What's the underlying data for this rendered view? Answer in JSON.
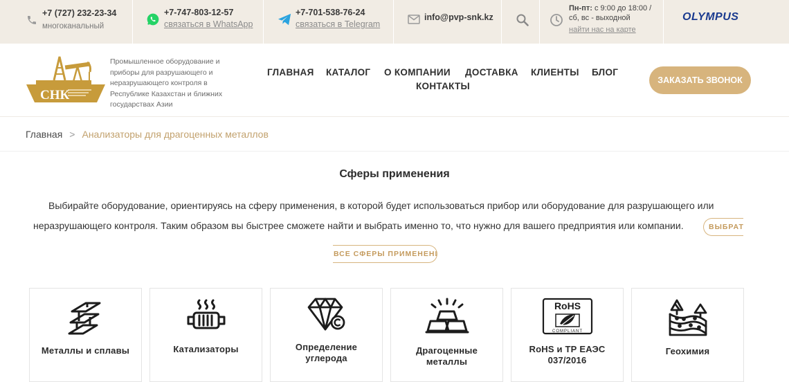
{
  "topbar": {
    "phone": {
      "number": "+7 (727) 232-23-34",
      "note": "многоканальный",
      "icon": "phone-icon"
    },
    "whatsapp": {
      "number": "+7-747-803-12-57",
      "link": "связаться в WhatsApp",
      "icon": "whatsapp-icon"
    },
    "telegram": {
      "number": "+7-701-538-76-24",
      "link": "связаться в Telegram",
      "icon": "telegram-icon"
    },
    "email": {
      "address": "info@pvp-snk.kz",
      "icon": "mail-icon"
    },
    "search": {
      "icon": "search-icon"
    },
    "hours": {
      "days_label": "Пн-пт:",
      "days_time": " с 9:00 до 18:00 /",
      "weekend": "сб, вс - выходной",
      "map_link": "найти нас на карте",
      "icon": "clock-icon"
    },
    "partner_logo": "OLYMPUS"
  },
  "header": {
    "logo_text": "СНК",
    "tagline": "Промышленное оборудование и приборы для разрушающего и неразрушающего контроля в Республике Казахстан и ближних государствах Азии",
    "nav": [
      "ГЛАВНАЯ",
      "КАТАЛОГ",
      "О КОМПАНИИ",
      "ДОСТАВКА",
      "КЛИЕНТЫ",
      "БЛОГ",
      "КОНТАКТЫ"
    ],
    "cta_label": "ЗАКАЗАТЬ ЗВОНОК"
  },
  "breadcrumb": {
    "home": "Главная",
    "separator": ">",
    "current": "Анализаторы для драгоценных металлов"
  },
  "spheres": {
    "title": "Сферы применения",
    "text_line1": "Выбирайте оборудование, ориентируясь на сферу применения, в которой будет использоваться прибор или оборудование для разрушающего или",
    "text_line2": "неразрушающего контроля. Таким образом вы быстрее сможете найти и выбрать именно то, что нужно для вашего предприятия или компании.",
    "select_button_part1": "ВЫБРАТЬ",
    "select_button_part2": "ВСЕ СФЕРЫ ПРИМЕНЕНИЯ",
    "cards": [
      {
        "label": "Металлы и сплавы",
        "icon": "metal-beams-icon"
      },
      {
        "label": "Катализаторы",
        "icon": "catalytic-converter-icon"
      },
      {
        "label": "Определение углерода",
        "icon": "diamond-icon"
      },
      {
        "label": "Драгоценные металлы",
        "icon": "gold-bars-icon"
      },
      {
        "label": "RoHS и ТР ЕАЭС 037/2016",
        "icon": "rohs-compliant-icon"
      },
      {
        "label": "Геохимия",
        "icon": "geochemistry-icon"
      }
    ]
  },
  "colors": {
    "accent": "#d7b47d",
    "topbar_bg": "#f1ece4",
    "breadcrumb_current": "#c2a16d",
    "olympus_blue": "#1a3a8f"
  }
}
